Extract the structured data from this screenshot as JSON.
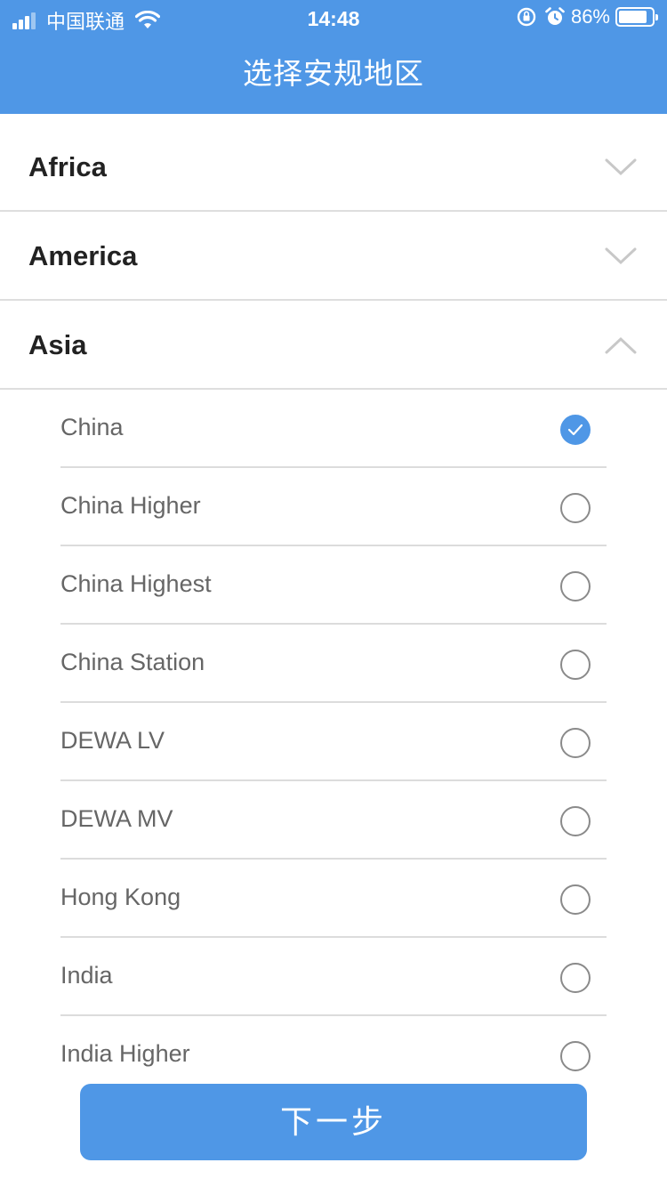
{
  "status_bar": {
    "carrier": "中国联通",
    "time": "14:48",
    "battery": "86%",
    "battery_level": 0.86
  },
  "header": {
    "title": "选择安规地区"
  },
  "colors": {
    "accent": "#4f97e6",
    "divider": "#dedede",
    "text_primary": "#222222",
    "text_secondary": "#666666"
  },
  "groups": [
    {
      "label": "Africa",
      "expanded": false,
      "icon": "chevron-down-icon"
    },
    {
      "label": "America",
      "expanded": false,
      "icon": "chevron-down-icon"
    },
    {
      "label": "Asia",
      "expanded": true,
      "icon": "chevron-up-icon"
    }
  ],
  "options": [
    {
      "label": "China",
      "selected": true
    },
    {
      "label": "China Higher",
      "selected": false
    },
    {
      "label": "China Highest",
      "selected": false
    },
    {
      "label": "China Station",
      "selected": false
    },
    {
      "label": "DEWA LV",
      "selected": false
    },
    {
      "label": "DEWA MV",
      "selected": false
    },
    {
      "label": "Hong Kong",
      "selected": false
    },
    {
      "label": "India",
      "selected": false
    },
    {
      "label": "India Higher",
      "selected": false
    }
  ],
  "footer": {
    "next_label": "下一步"
  }
}
